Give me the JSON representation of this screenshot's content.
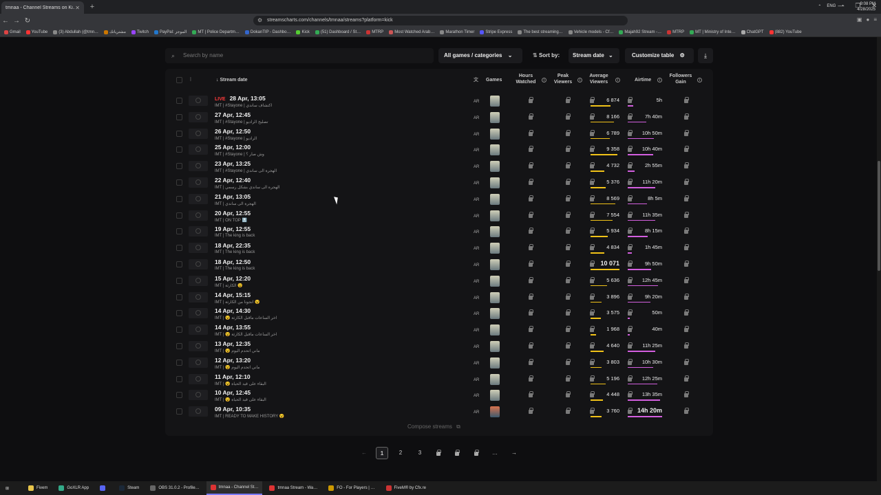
{
  "browser": {
    "tab_title": "tmnaa - Channel Streams on Ki…",
    "url": "streamscharts.com/channels/tmnaa/streams?platform=kick",
    "bookmarks": [
      "Gmail",
      "YouTube",
      "(3) Abdullah (@tmn…",
      "مشترياتك",
      "Twitch",
      "PayPal: الموجز",
      "MT | Police Departm…",
      "DokanTIP - Dashbo…",
      "Kick",
      "(51) Dashboard / St…",
      "MTRP",
      "Most Watched Arab…",
      "Marathon Timer",
      "Stripe Express",
      "The best streaming…",
      "Vehicle models - Cf…",
      "Majah92 Stream -…",
      "MTRP",
      "MT | Ministry of Inte…",
      "ChatGPT",
      "(882) YouTube"
    ]
  },
  "filters": {
    "search_placeholder": "Search by name",
    "games_label": "All games / categories",
    "sort_label": "Sort by:",
    "sort_value": "Stream date",
    "customize_label": "Customize table"
  },
  "table": {
    "headers": {
      "stream_date": "Stream date",
      "games": "Games",
      "hours_watched": "Hours Watched",
      "peak_viewers": "Peak Viewers",
      "average_viewers": "Average Viewers",
      "airtime": "Airtime",
      "followers_gain": "Followers Gain"
    },
    "rows": [
      {
        "live": "LIVE",
        "date": "28 Apr, 13:05",
        "title": "IMT | #Stayone | اكتشاف ساندي",
        "lang": "AR",
        "avg": "6 874",
        "avg_pct": 0.68,
        "air": "5h",
        "air_pct": 0.15,
        "alt": false
      },
      {
        "date": "27 Apr, 12:45",
        "title": "IMT | #Stayone | تصليح الراديو",
        "lang": "AR",
        "avg": "8 166",
        "avg_pct": 0.81,
        "air": "7h 40m",
        "air_pct": 0.53,
        "alt": false
      },
      {
        "date": "26 Apr, 12:50",
        "title": "IMT | #Stayone | الراديو",
        "lang": "AR",
        "avg": "6 789",
        "avg_pct": 0.67,
        "air": "10h 50m",
        "air_pct": 0.75,
        "alt": false
      },
      {
        "date": "25 Apr, 12:00",
        "title": "IMT | #Stayone | وش صار ؟",
        "lang": "AR",
        "avg": "9 358",
        "avg_pct": 0.93,
        "air": "10h 40m",
        "air_pct": 0.74,
        "alt": false
      },
      {
        "date": "23 Apr, 13:25",
        "title": "IMT | #Stayone | الهجرة الى ساندي",
        "lang": "AR",
        "avg": "4 732",
        "avg_pct": 0.47,
        "air": "2h 55m",
        "air_pct": 0.2,
        "alt": false
      },
      {
        "date": "22 Apr, 12:40",
        "title": "IMT | الهجرة الى ساندي بشكل رسمي",
        "lang": "AR",
        "avg": "5 376",
        "avg_pct": 0.53,
        "air": "11h 20m",
        "air_pct": 0.79,
        "alt": false
      },
      {
        "date": "21 Apr, 13:05",
        "title": "IMT | الهجرة الى ساندي",
        "lang": "AR",
        "avg": "8 569",
        "avg_pct": 0.85,
        "air": "8h 5m",
        "air_pct": 0.56,
        "alt": false
      },
      {
        "date": "20 Apr, 12:55",
        "title": "IMT | ON TOP 🔝",
        "lang": "AR",
        "avg": "7 554",
        "avg_pct": 0.75,
        "air": "11h 35m",
        "air_pct": 0.8,
        "alt": false
      },
      {
        "date": "19 Apr, 12:55",
        "title": "IMT | The king is back",
        "lang": "AR",
        "avg": "5 934",
        "avg_pct": 0.59,
        "air": "8h 15m",
        "air_pct": 0.57,
        "alt": false
      },
      {
        "date": "18 Apr, 22:35",
        "title": "IMT | The king is back",
        "lang": "AR",
        "avg": "4 834",
        "avg_pct": 0.48,
        "air": "1h 45m",
        "air_pct": 0.12,
        "alt": false
      },
      {
        "date": "18 Apr, 12:50",
        "title": "IMT | The king is back",
        "lang": "AR",
        "avg": "10 071",
        "avg_pct": 1.0,
        "air": "9h 50m",
        "air_pct": 0.68,
        "alt": false,
        "big_avg": true
      },
      {
        "date": "15 Apr, 12:20",
        "title": "IMT | الكارثة 😵",
        "lang": "AR",
        "avg": "5 636",
        "avg_pct": 0.56,
        "air": "12h 45m",
        "air_pct": 0.88,
        "alt": false
      },
      {
        "date": "14 Apr, 15:15",
        "title": "IMT | انجونا من الكارثة 😵",
        "lang": "AR",
        "avg": "3 896",
        "avg_pct": 0.39,
        "air": "9h 20m",
        "air_pct": 0.65,
        "alt": false
      },
      {
        "date": "14 Apr, 14:30",
        "title": "IMT | 😵 اخر الساعات ماقبل الكارثة",
        "lang": "AR",
        "avg": "3 575",
        "avg_pct": 0.35,
        "air": "50m",
        "air_pct": 0.06,
        "alt": false
      },
      {
        "date": "14 Apr, 13:55",
        "title": "IMT | 😵 اخر الساعات ماقبل الكارثة",
        "lang": "AR",
        "avg": "1 968",
        "avg_pct": 0.2,
        "air": "40m",
        "air_pct": 0.05,
        "alt": false
      },
      {
        "date": "13 Apr, 12:35",
        "title": "IMT | 😵 ماني اتحدم اليوم",
        "lang": "AR",
        "avg": "4 640",
        "avg_pct": 0.46,
        "air": "11h 25m",
        "air_pct": 0.79,
        "alt": false
      },
      {
        "date": "12 Apr, 13:20",
        "title": "IMT | 😵 ماني اتحدم اليوم",
        "lang": "AR",
        "avg": "3 803",
        "avg_pct": 0.38,
        "air": "10h 30m",
        "air_pct": 0.73,
        "alt": false
      },
      {
        "date": "11 Apr, 12:10",
        "title": "IMT | 😵 البقاء على قيد الحياة",
        "lang": "AR",
        "avg": "5 196",
        "avg_pct": 0.52,
        "air": "12h 25m",
        "air_pct": 0.86,
        "alt": false
      },
      {
        "date": "10 Apr, 12:45",
        "title": "IMT | 😵 البقاء على قيد الحياة",
        "lang": "AR",
        "avg": "4 448",
        "avg_pct": 0.44,
        "air": "13h 35m",
        "air_pct": 0.94,
        "alt": false
      },
      {
        "date": "09 Apr, 10:35",
        "title": "IMT | READY TO MAKE HISTORY 😵",
        "lang": "AR",
        "avg": "3 760",
        "avg_pct": 0.37,
        "air": "14h 20m",
        "air_pct": 1.0,
        "alt": true,
        "big_air": true
      }
    ],
    "compose_label": "Compose streams"
  },
  "pager": {
    "prev": "←",
    "pages": [
      "1",
      "2",
      "3"
    ],
    "more": "…",
    "next": "→"
  },
  "taskbar": {
    "items": [
      "Fivem",
      "GoXLR App",
      "",
      "Steam",
      "OBS 31.0.2 - Profile…",
      "tmnaa - Channel St…",
      "tmnaa Stream - Wa…",
      "FO - For Players | …",
      "FiveM® by Cfx.re"
    ],
    "lang": "ENG",
    "time": "9:08 PM",
    "date": "4/28/2025"
  }
}
